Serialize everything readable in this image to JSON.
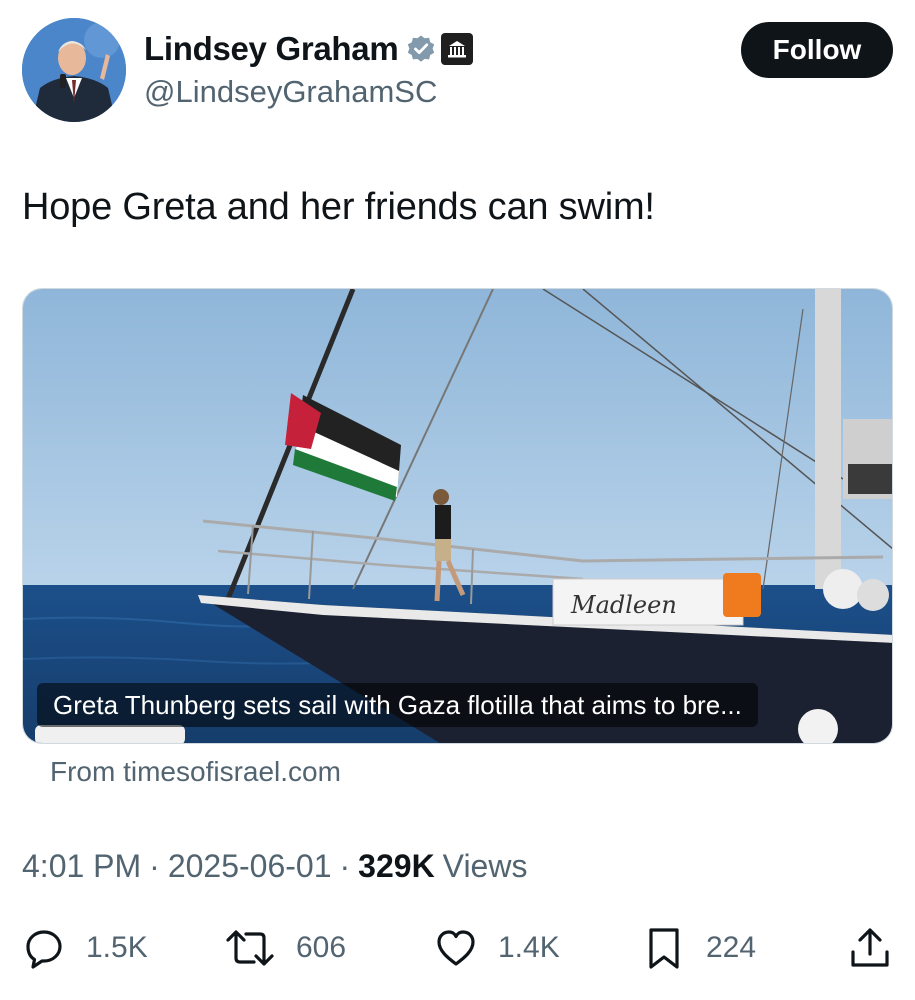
{
  "author": {
    "display_name": "Lindsey Graham",
    "handle": "@LindseyGrahamSC",
    "verified_icon": "verified-badge-icon",
    "affiliation_icon": "government-building-icon"
  },
  "follow_button": {
    "label": "Follow"
  },
  "tweet": {
    "text": "Hope Greta and her friends can swim!"
  },
  "link_card": {
    "caption": "Greta Thunberg sets sail with Gaza flotilla that aims to bre...",
    "source": "From timesofisrael.com",
    "boat_name": "Madleen"
  },
  "meta": {
    "time": "4:01 PM",
    "separator": "·",
    "date": "2025-06-01",
    "views_count": "329K",
    "views_label": "Views"
  },
  "actions": {
    "replies": "1.5K",
    "reposts": "606",
    "likes": "1.4K",
    "bookmarks": "224"
  },
  "colors": {
    "text_primary": "#0f1419",
    "text_secondary": "#536471",
    "verified_blue": "#829aab",
    "follow_bg": "#0f1419"
  }
}
